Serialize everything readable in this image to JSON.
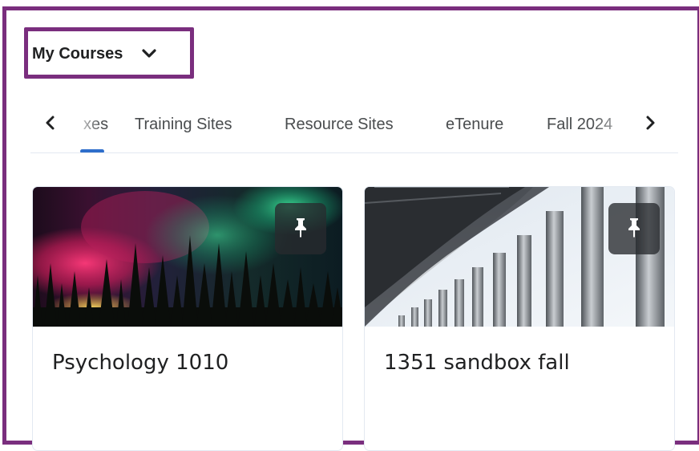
{
  "header": {
    "dropdown_label": "My Courses"
  },
  "tabs": {
    "items": [
      {
        "label": "xes"
      },
      {
        "label": "Training Sites"
      },
      {
        "label": "Resource Sites"
      },
      {
        "label": "eTenure"
      },
      {
        "label": "Fall 2024"
      }
    ]
  },
  "courses": [
    {
      "title": "Psychology 1010",
      "image": "aurora-forest-image"
    },
    {
      "title": "1351 sandbox fall",
      "image": "building-columns-image"
    }
  ],
  "colors": {
    "highlight": "#7a2e7e",
    "active_tab": "#2e6ecb"
  }
}
